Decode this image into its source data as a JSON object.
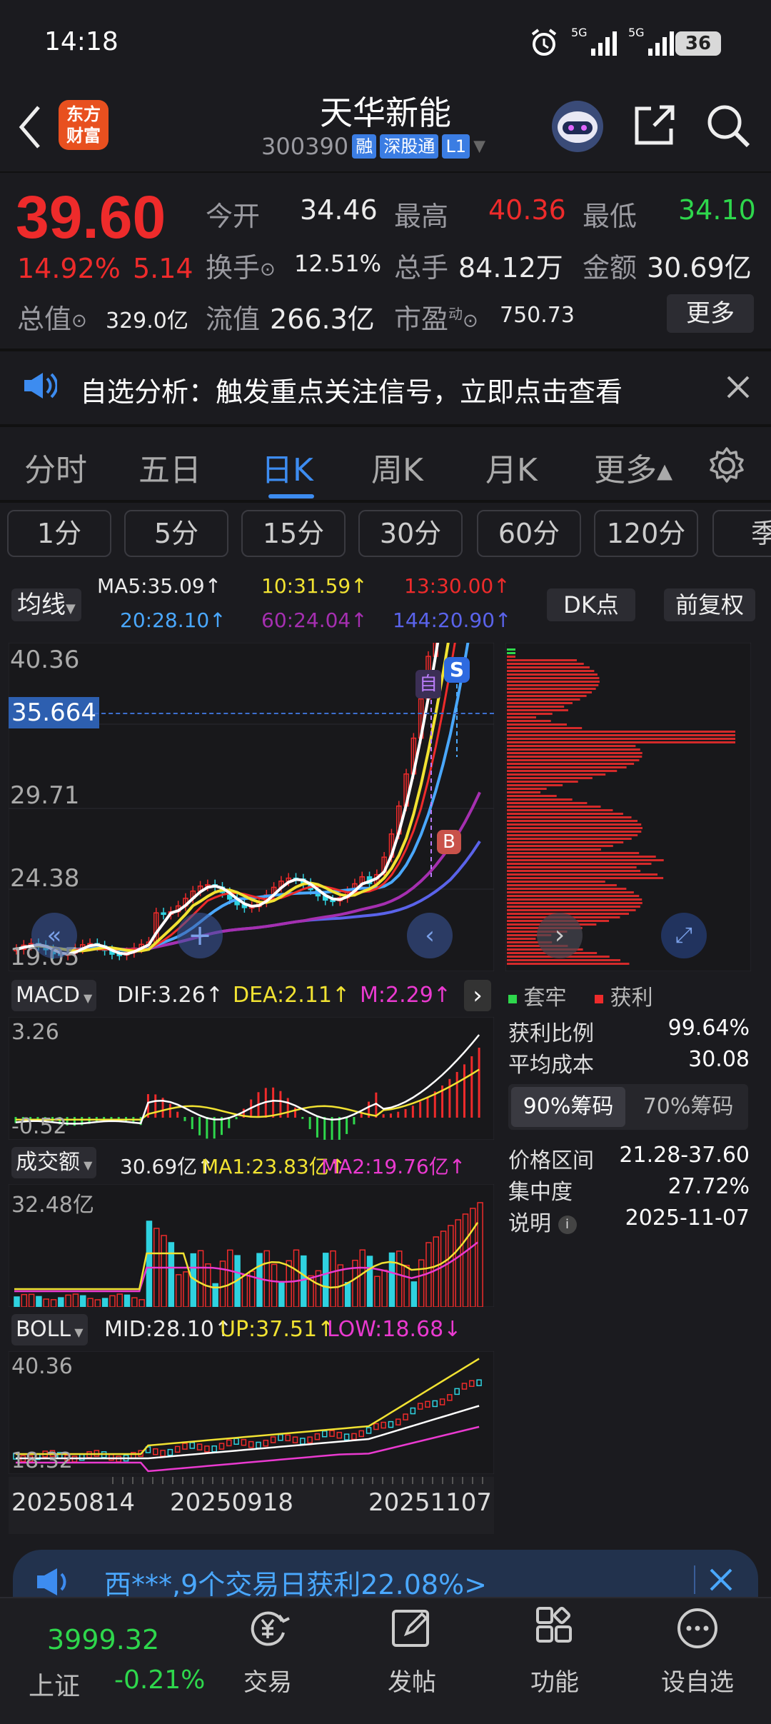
{
  "status_bar": {
    "time": "14:18",
    "signal1": "5G",
    "signal2": "5G",
    "battery": "36"
  },
  "header": {
    "logo_line1": "东方",
    "logo_line2": "财富",
    "title": "天华新能",
    "code": "300390",
    "tags": [
      "融",
      "深股通",
      "L1"
    ]
  },
  "quote": {
    "price": "39.60",
    "change_pct": "14.92%",
    "change": "5.14",
    "open_label": "今开",
    "open": "34.46",
    "high_label": "最高",
    "high": "40.36",
    "low_label": "最低",
    "low": "34.10",
    "turnover_label": "换手",
    "turnover": "12.51%",
    "volume_label": "总手",
    "volume": "84.12万",
    "amount_label": "金额",
    "amount": "30.69亿",
    "mcap_label": "总值",
    "mcap": "329.0亿",
    "float_label": "流值",
    "float": "266.3亿",
    "pe_label": "市盈",
    "pe_sup": "动",
    "pe": "750.73",
    "more_button": "更多"
  },
  "notice": {
    "text": "自选分析：触发重点关注信号，立即点击查看"
  },
  "period_tabs": {
    "items": [
      "分时",
      "五日",
      "日K",
      "周K",
      "月K",
      "更多▴"
    ],
    "active": 2
  },
  "minute_tabs": [
    "1分",
    "5分",
    "15分",
    "30分",
    "60分",
    "120分",
    "季"
  ],
  "ma_legend": {
    "selector": "均线",
    "ma5": "MA5:35.09↑",
    "ma10": "10:31.59↑",
    "ma13": "13:30.00↑",
    "ma20": "20:28.10↑",
    "ma60": "60:24.04↑",
    "ma144": "144:20.90↑",
    "dk_button": "DK点",
    "adjust_button": "前复权",
    "colors": {
      "ma5": "#ffffff",
      "ma10": "#f1e232",
      "ma13": "#ee2b2b",
      "ma20": "#4aa8ff",
      "ma60": "#a52fb0",
      "ma144": "#5a63ea"
    }
  },
  "kline": {
    "y_labels": [
      "40.36",
      "29.71",
      "24.38",
      "19.05"
    ],
    "crosshair_value": "35.664",
    "marker_zi": "自",
    "marker_s": "S",
    "marker_b": "B"
  },
  "chips": {
    "legend_trap": "套牢",
    "legend_profit": "获利",
    "rows": [
      {
        "label": "获利比例",
        "value": "99.64%"
      },
      {
        "label": "平均成本",
        "value": "30.08"
      }
    ],
    "tab_90": "90%筹码",
    "tab_70": "70%筹码",
    "details": [
      {
        "label": "价格区间",
        "value": "21.28-37.60"
      },
      {
        "label": "集中度",
        "value": "27.72%"
      },
      {
        "label": "说明",
        "value": "2025-11-07"
      }
    ]
  },
  "macd": {
    "selector": "MACD",
    "dif": "DIF:3.26↑",
    "dea": "DEA:2.11↑",
    "m": "M:2.29↑",
    "y_top": "3.26",
    "y_bottom": "-0.52"
  },
  "volume": {
    "selector": "成交额",
    "value": "30.69亿↑",
    "ma1": "MA1:23.83亿↑",
    "ma2": "MA2:19.76亿↑",
    "y_top": "32.48亿"
  },
  "boll": {
    "selector": "BOLL",
    "mid": "MID:28.10↑",
    "up": "UP:37.51↑",
    "low": "LOW:18.68↓",
    "y_top": "40.36",
    "y_bottom": "18.32"
  },
  "dates": [
    "20250814",
    "20250918",
    "20251107"
  ],
  "bottom_ad": {
    "text": "西***,9个交易日获利22.08%>"
  },
  "bottom_nav": {
    "index_value": "3999.32",
    "index_name": "上证",
    "index_change": "-0.21%",
    "items": [
      "交易",
      "发帖",
      "功能",
      "设自选"
    ]
  }
}
